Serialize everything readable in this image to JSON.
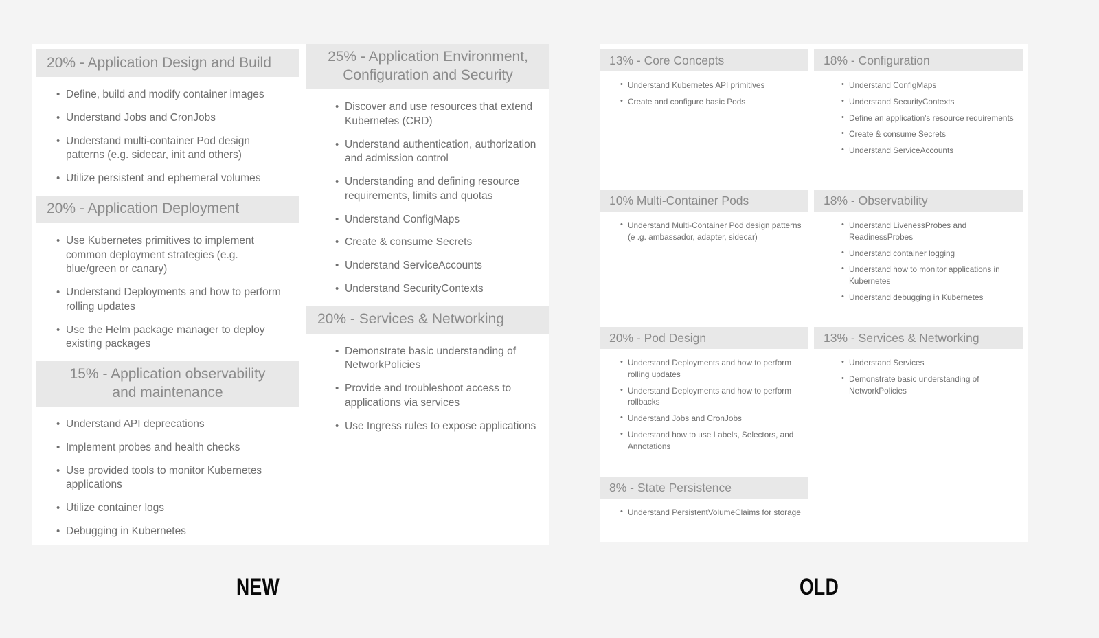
{
  "captions": {
    "new": "NEW",
    "old": "OLD"
  },
  "colors": {
    "page_background": "#f4f4f4",
    "panel_background": "#ffffff",
    "header_band": "#e8e8e8",
    "header_text": "#8b8b8b",
    "body_text": "#6f6f6f",
    "caption_text": "#080808"
  },
  "bullet_glyph": "•",
  "new_curriculum": {
    "label": "NEW",
    "columns": [
      {
        "sections": [
          {
            "heading": "20% - Application Design and Build",
            "heading_lines": [
              "20% - Application Design and Build"
            ],
            "percent": "20%",
            "title": "Application Design and Build",
            "centered": false,
            "items": [
              "Define, build and modify container images",
              "Understand Jobs and CronJobs",
              "Understand multi-container Pod design patterns (e.g. sidecar, init and others)",
              "Utilize persistent and ephemeral volumes"
            ]
          },
          {
            "heading": "20% - Application Deployment",
            "heading_lines": [
              "20% - Application Deployment"
            ],
            "percent": "20%",
            "title": "Application Deployment",
            "centered": false,
            "items": [
              "Use Kubernetes primitives to implement common deployment strategies (e.g. blue/green or canary)",
              "Understand Deployments and how to perform rolling updates",
              "Use the Helm package manager to deploy existing packages"
            ]
          },
          {
            "heading": "15% - Application observability and maintenance",
            "heading_lines": [
              "15% - Application observability",
              "and maintenance"
            ],
            "percent": "15%",
            "title": "Application observability and maintenance",
            "centered": true,
            "items": [
              "Understand API deprecations",
              "Implement probes and health checks",
              "Use provided tools to monitor Kubernetes applications",
              "Utilize container logs",
              "Debugging in Kubernetes"
            ]
          }
        ]
      },
      {
        "sections": [
          {
            "heading": "25% - Application Environment, Configuration and Security",
            "heading_lines": [
              "25% - Application Environment,",
              "Configuration and Security"
            ],
            "percent": "25%",
            "title": "Application Environment, Configuration and Security",
            "centered": true,
            "items": [
              "Discover and use resources that extend Kubernetes (CRD)",
              "Understand authentication, authorization and admission control",
              "Understanding and defining resource requirements, limits and quotas",
              "Understand ConfigMaps",
              "Create & consume Secrets",
              "Understand ServiceAccounts",
              "Understand SecurityContexts"
            ]
          },
          {
            "heading": "20% - Services & Networking",
            "heading_lines": [
              "20% - Services & Networking"
            ],
            "percent": "20%",
            "title": "Services & Networking",
            "centered": false,
            "items": [
              "Demonstrate basic understanding of NetworkPolicies",
              "Provide and troubleshoot access to applications via services",
              "Use Ingress rules to expose applications"
            ]
          }
        ]
      }
    ]
  },
  "old_curriculum": {
    "label": "OLD",
    "columns": [
      {
        "sections": [
          {
            "heading": "13% - Core Concepts",
            "percent": "13%",
            "title": "Core Concepts",
            "block_height": 204,
            "items": [
              "Understand Kubernetes API primitives",
              "Create and configure basic Pods"
            ]
          },
          {
            "heading": "10% Multi-Container Pods",
            "percent": "10%",
            "title": "Multi-Container Pods",
            "block_height": 200,
            "items": [
              "Understand Multi-Container Pod design patterns (e .g. ambassador, adapter, sidecar)"
            ]
          },
          {
            "heading": "20% - Pod Design",
            "percent": "20%",
            "title": "Pod Design",
            "block_height": 218,
            "items": [
              "Understand Deployments and how to perform rolling updates",
              "Understand Deployments and how to perform rollbacks",
              "Understand Jobs and CronJobs",
              "Understand how to use Labels, Selectors, and Annotations"
            ]
          },
          {
            "heading": "8% - State Persistence",
            "percent": "8%",
            "title": "State Persistence",
            "block_height": 90,
            "items": [
              "Understand PersistentVolumeClaims for storage"
            ]
          }
        ]
      },
      {
        "sections": [
          {
            "heading": "18% - Configuration",
            "percent": "18%",
            "title": "Configuration",
            "block_height": 204,
            "items": [
              "Understand ConfigMaps",
              "Understand SecurityContexts",
              "Define an application's resource requirements",
              "Create & consume Secrets",
              "Understand ServiceAccounts"
            ]
          },
          {
            "heading": "18% - Observability",
            "percent": "18%",
            "title": "Observability",
            "block_height": 200,
            "items": [
              "Understand LivenessProbes and ReadinessProbes",
              "Understand container logging",
              "Understand how to monitor applications in Kubernetes",
              "Understand debugging in Kubernetes"
            ]
          },
          {
            "heading": "13% - Services & Networking",
            "percent": "13%",
            "title": "Services & Networking",
            "block_height": 218,
            "items": [
              "Understand Services",
              "Demonstrate basic understanding of NetworkPolicies"
            ]
          }
        ]
      }
    ]
  }
}
